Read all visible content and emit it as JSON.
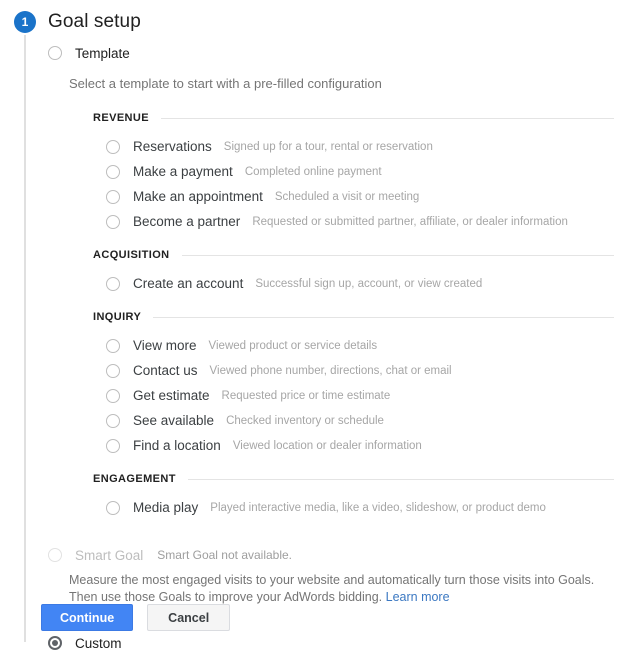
{
  "step": {
    "number": "1",
    "title": "Goal setup",
    "accent_color": "#1a73c9"
  },
  "template_option": {
    "label": "Template",
    "help_text": "Select a template to start with a pre-filled configuration",
    "selected": false
  },
  "groups": [
    {
      "title": "REVENUE",
      "items": [
        {
          "label": "Reservations",
          "description": "Signed up for a tour, rental or reservation"
        },
        {
          "label": "Make a payment",
          "description": "Completed online payment"
        },
        {
          "label": "Make an appointment",
          "description": "Scheduled a visit or meeting"
        },
        {
          "label": "Become a partner",
          "description": "Requested or submitted partner, affiliate, or dealer information"
        }
      ]
    },
    {
      "title": "ACQUISITION",
      "items": [
        {
          "label": "Create an account",
          "description": "Successful sign up, account, or view created"
        }
      ]
    },
    {
      "title": "INQUIRY",
      "items": [
        {
          "label": "View more",
          "description": "Viewed product or service details"
        },
        {
          "label": "Contact us",
          "description": "Viewed phone number, directions, chat or email"
        },
        {
          "label": "Get estimate",
          "description": "Requested price or time estimate"
        },
        {
          "label": "See available",
          "description": "Checked inventory or schedule"
        },
        {
          "label": "Find a location",
          "description": "Viewed location or dealer information"
        }
      ]
    },
    {
      "title": "ENGAGEMENT",
      "items": [
        {
          "label": "Media play",
          "description": "Played interactive media, like a video, slideshow, or product demo"
        }
      ]
    }
  ],
  "smart_goal": {
    "label": "Smart Goal",
    "note": "Smart Goal not available.",
    "description": "Measure the most engaged visits to your website and automatically turn those visits into Goals. Then use those Goals to improve your AdWords bidding.",
    "link_label": "Learn more",
    "disabled": true
  },
  "custom_option": {
    "label": "Custom",
    "selected": true
  },
  "footer": {
    "continue_label": "Continue",
    "cancel_label": "Cancel",
    "primary_color": "#4285f4"
  }
}
